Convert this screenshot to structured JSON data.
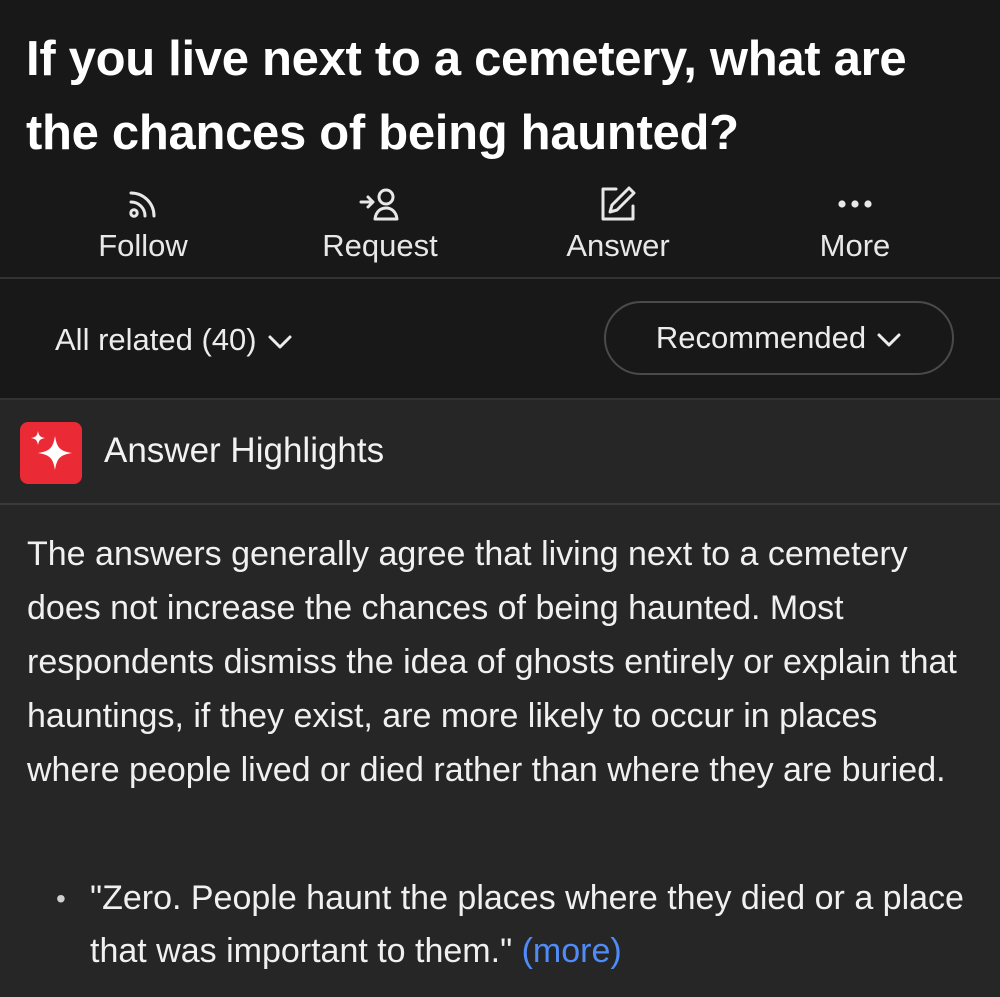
{
  "question": {
    "title": "If you live next to a cemetery, what are the chances of being haunted?"
  },
  "actions": [
    {
      "label": "Follow",
      "icon": "follow-feed-icon"
    },
    {
      "label": "Request",
      "icon": "request-person-icon"
    },
    {
      "label": "Answer",
      "icon": "pencil-square-icon"
    },
    {
      "label": "More",
      "icon": "ellipsis-icon"
    }
  ],
  "filters": {
    "related_label": "All related (40)",
    "sort_label": "Recommended"
  },
  "highlights": {
    "title": "Answer Highlights",
    "icon": "sparkle-icon",
    "icon_color": "#ea2b36",
    "summary": "The answers generally agree that living next to a cemetery does not increase the chances of being haunted. Most respondents dismiss the idea of ghosts entirely or explain that hauntings, if they exist, are more likely to occur in places where people lived or died rather than where they are buried.",
    "quotes": [
      {
        "text": "\"Zero. People haunt the places where they died or a place that was important to them.\"",
        "more_label": "(more)"
      }
    ]
  },
  "colors": {
    "background": "#181818",
    "card": "#262626",
    "link": "#4f8cf7"
  }
}
